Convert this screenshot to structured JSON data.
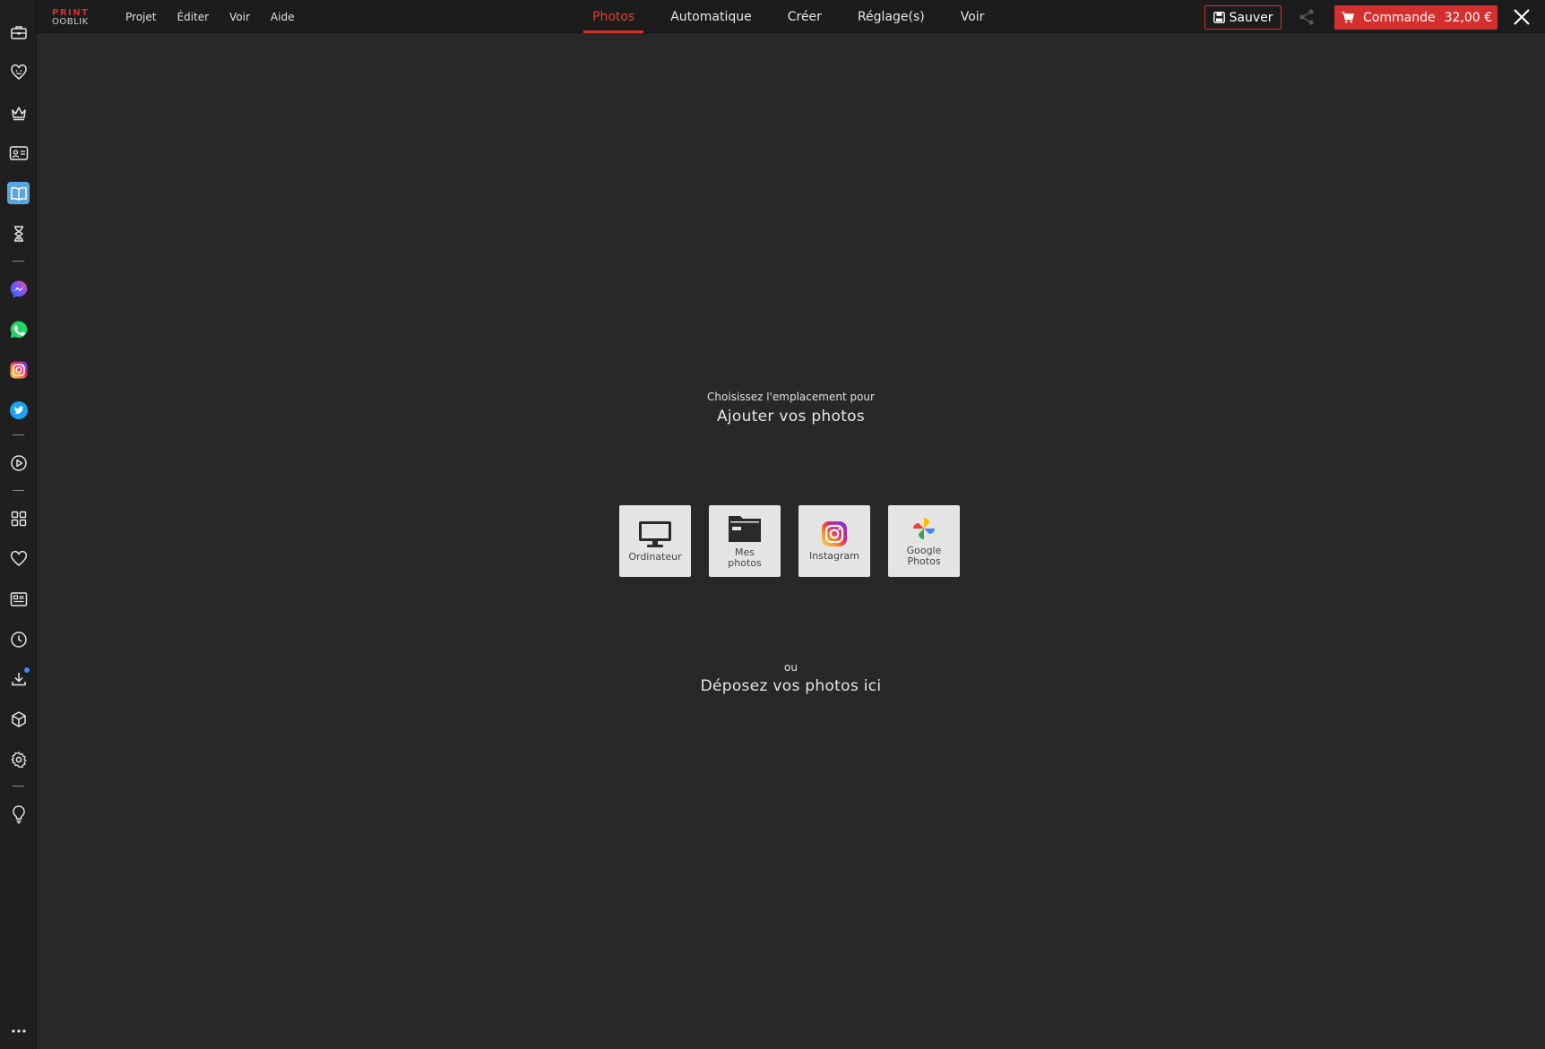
{
  "logo": {
    "line1": "PRINT",
    "line2": "OOBLIK"
  },
  "menu": [
    "Projet",
    "Éditer",
    "Voir",
    "Aide"
  ],
  "tabs": [
    "Photos",
    "Automatique",
    "Créer",
    "Réglage(s)",
    "Voir"
  ],
  "active_tab": "Photos",
  "toolbar": {
    "save_label": "Sauver",
    "order_label": "Commande",
    "order_price": "32,00 €"
  },
  "sidebar": {
    "items": [
      "briefcase-icon",
      "heart-face-icon",
      "crown-icon",
      "photo-card-icon",
      "book-icon",
      "hourglass-icon",
      "messenger-icon",
      "whatsapp-icon",
      "instagram-icon",
      "twitter-icon",
      "play-icon",
      "grid-icon",
      "heart-icon",
      "news-icon",
      "clock-icon",
      "download-icon",
      "cube-icon",
      "gear-icon",
      "lightbulb-icon",
      "more-icon"
    ],
    "active": "book-icon"
  },
  "main": {
    "choose_small": "Choisissez l'emplacement pour",
    "choose_big": "Ajouter vos photos",
    "sources": [
      {
        "label_1": "Ordinateur",
        "label_2": "",
        "icon": "monitor-icon"
      },
      {
        "label_1": "Mes",
        "label_2": "photos",
        "icon": "folder-icon"
      },
      {
        "label_1": "Instagram",
        "label_2": "",
        "icon": "instagram-icon"
      },
      {
        "label_1": "Google",
        "label_2": "Photos",
        "icon": "google-photos-icon"
      }
    ],
    "or_label": "ou",
    "drop_label": "Déposez vos photos ici"
  },
  "colors": {
    "accent": "#d32f2f",
    "background": "#282828",
    "topbar": "#1c1c1c",
    "sidebar": "#1f1f1f",
    "tile": "#e4e4e4"
  }
}
